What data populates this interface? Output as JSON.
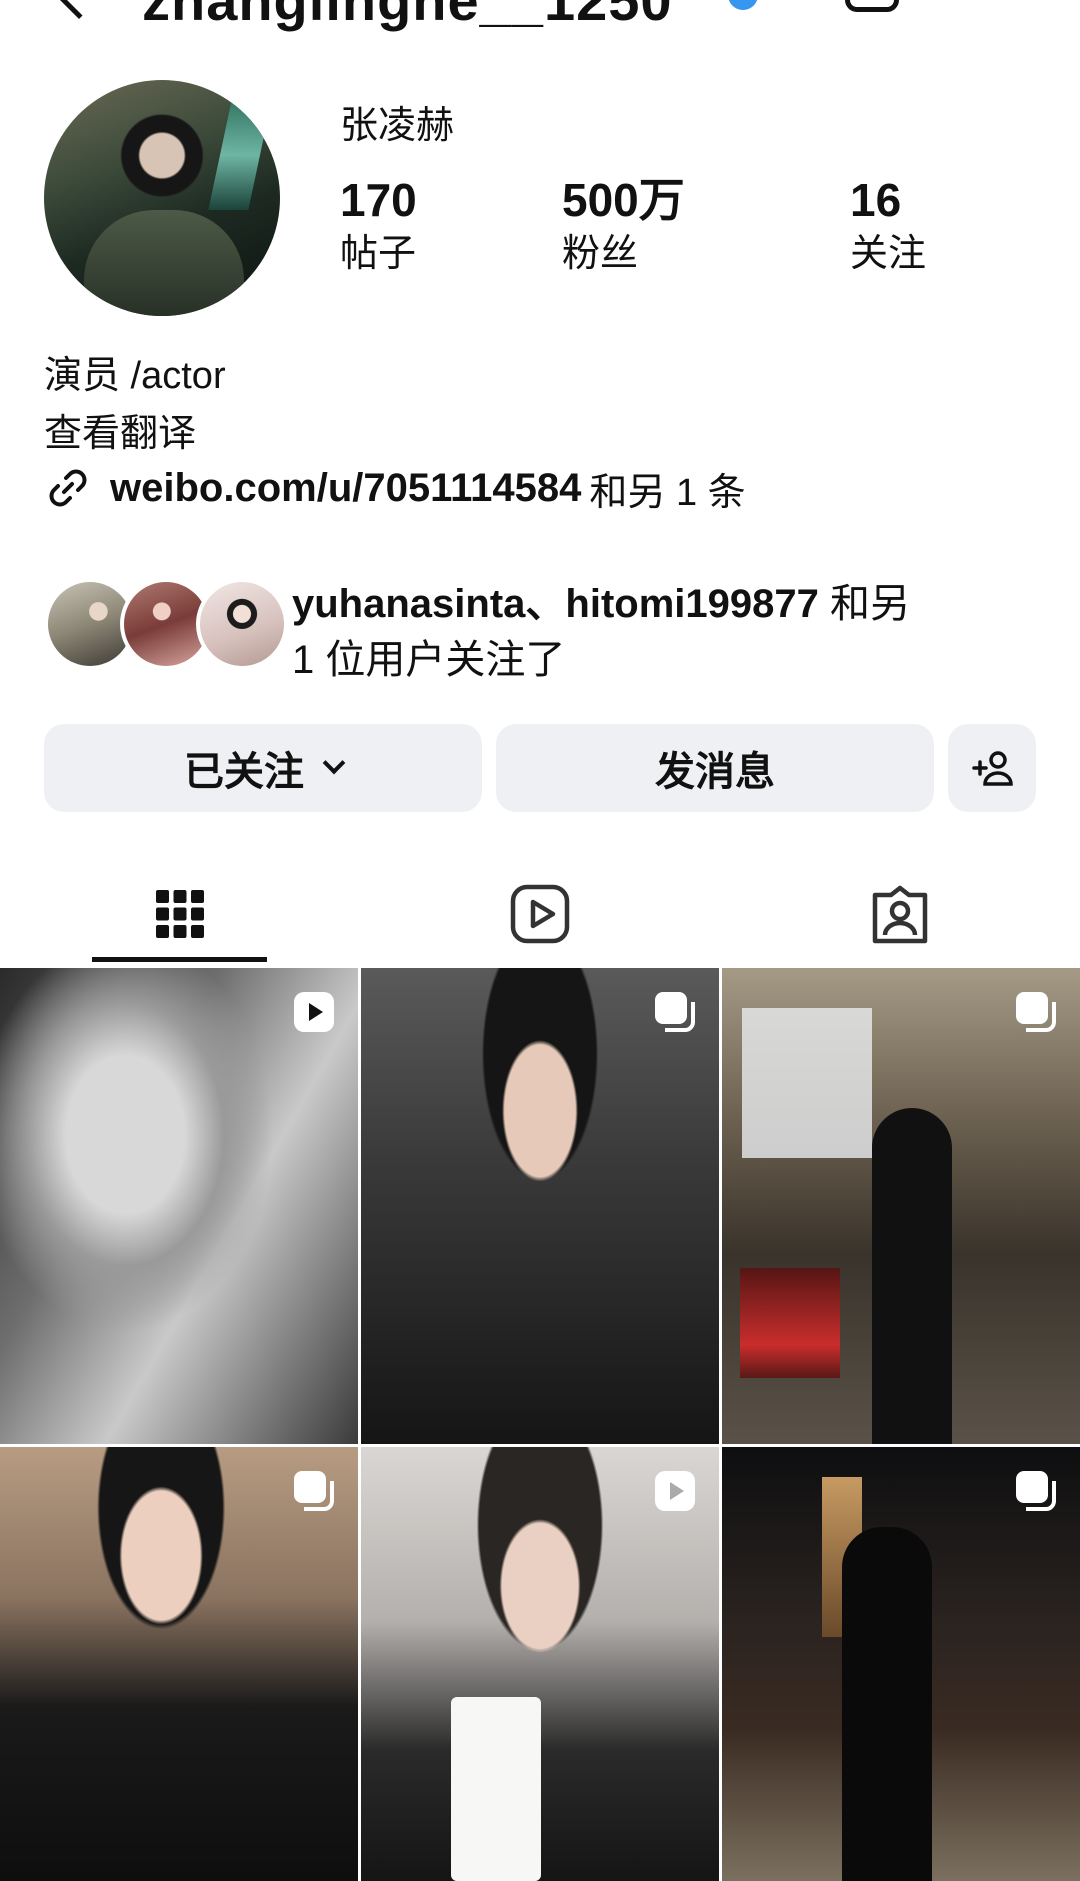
{
  "header": {
    "username": "zhanglinghe__1250",
    "icons": [
      "back-icon",
      "verified-badge-icon",
      "notifications-bell-icon"
    ]
  },
  "profile": {
    "display_name": "张凌赫",
    "stats": [
      {
        "value": "170",
        "label": "帖子"
      },
      {
        "value": "500万",
        "label": "粉丝"
      },
      {
        "value": "16",
        "label": "关注"
      }
    ],
    "bio": {
      "line1": "演员 /actor",
      "translate": "查看翻译",
      "link": "weibo.com/u/7051114584",
      "link_more": "和另 1 条"
    }
  },
  "mutual": {
    "users": "yuhanasinta、hitomi199877",
    "suffix_line1": "和另",
    "suffix_line2": "1 位用户关注了"
  },
  "actions": {
    "following": "已关注",
    "message": "发消息"
  },
  "tabs": [
    "grid-icon",
    "reels-icon",
    "tagged-icon"
  ],
  "posts": [
    {
      "type": "reel"
    },
    {
      "type": "carousel"
    },
    {
      "type": "carousel"
    },
    {
      "type": "carousel"
    },
    {
      "type": "reel"
    },
    {
      "type": "carousel"
    }
  ],
  "colors": {
    "button_bg": "#eef0f3",
    "verified": "#3797f0",
    "text": "#111111"
  }
}
